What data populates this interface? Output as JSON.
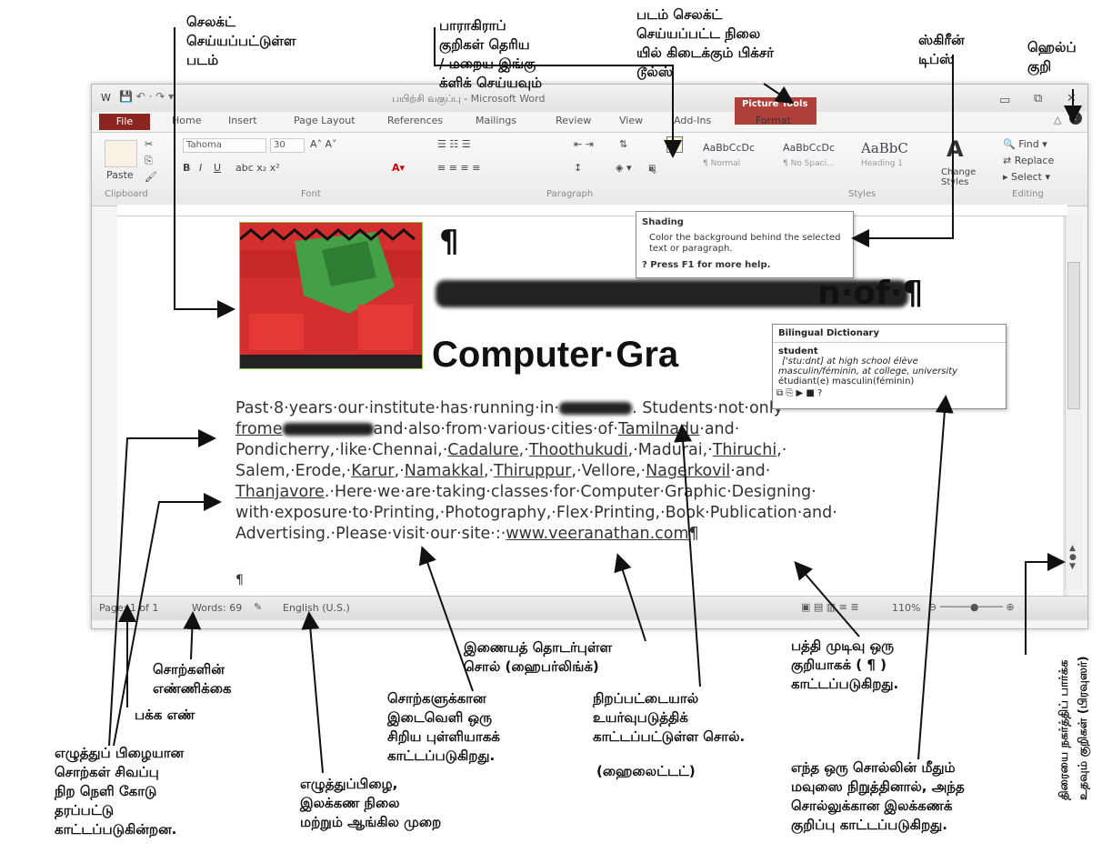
{
  "word": {
    "title": "பயிற்சி வகுப்பு - Microsoft Word",
    "file_tab": "File",
    "tabs": [
      "Home",
      "Insert",
      "Page Layout",
      "References",
      "Mailings",
      "Review",
      "View",
      "Add-Ins",
      "Format"
    ],
    "picture_tools": "Picture Tools",
    "font_name": "Tahoma",
    "font_size": "30",
    "groups": {
      "clipboard": "Clipboard",
      "font": "Font",
      "paragraph": "Paragraph",
      "styles": "Styles",
      "editing": "Editing"
    },
    "paste_label": "Paste",
    "styles": [
      "AaBbCcDc",
      "AaBbCcDc",
      "AaBbC"
    ],
    "style_names": [
      "¶ Normal",
      "¶ No Spaci...",
      "Heading 1"
    ],
    "change_styles": "Change Styles",
    "editing": {
      "find": "Find",
      "replace": "Replace",
      "select": "Select"
    },
    "tooltip": {
      "title": "Shading",
      "body": "Color the background behind the selected text or paragraph.",
      "help": "Press F1 for more help."
    },
    "dictionary": {
      "title": "Bilingual Dictionary",
      "word": "student",
      "line1": "['stu:dnt] at high school élève",
      "line2": "masculin/féminin, at college, university",
      "line3": "étudiant(e) masculin(féminin)"
    },
    "document": {
      "pilcrow_top": "¶",
      "heading1_tail": "n·of·¶",
      "heading2": "Computer·Gra",
      "para_line1_a": "Past·8·years·our·institute·has·running·in·",
      "para_line1_b": ". Students·not·only·",
      "para_line2_a": "frome",
      "para_line2_b": "and·also·from·various·cities·of·",
      "para_line2_link": "Tamilnadu",
      "para_line2_c": "·and·",
      "para_line3": [
        [
          "Pondicherry,·like·Chennai,·",
          false
        ],
        [
          "Cadalure",
          true
        ],
        [
          ",·",
          false
        ],
        [
          "Thoothukudi",
          true
        ],
        [
          ",·Madurai,·",
          false
        ],
        [
          "Thiruchi",
          true
        ],
        [
          ",·",
          false
        ]
      ],
      "para_line4": [
        [
          "Salem,·Erode,·",
          false
        ],
        [
          "Karur",
          true
        ],
        [
          ",·",
          false
        ],
        [
          "Namakkal",
          true
        ],
        [
          ",·",
          false
        ],
        [
          "Thiruppur",
          true
        ],
        [
          ",·Vellore,·",
          false
        ],
        [
          "Nagerkovil",
          true
        ],
        [
          "·and·",
          false
        ]
      ],
      "para_line5_link": "Thanjavore",
      "para_line5_b": ".·Here·we·are·taking·classes·for·Computer·Graphic·Designing·",
      "para_line6": "with·exposure·to·Printing,·Photography,·Flex·Printing,·Book·Publication·and·",
      "para_line7_a": "Advertising.·Please·visit·our·site·:·",
      "para_line7_link": "www.veeranathan.com",
      "para_line7_end": "¶",
      "pilcrow_bottom": "¶"
    },
    "status": {
      "page": "Page: 1 of 1",
      "words": "Words: 69",
      "language": "English (U.S.)",
      "zoom": "110%"
    }
  },
  "annotations": {
    "selected_picture": "செலக்ட்\nசெய்யப்பட்டுள்ள\nபடம்",
    "paragraph_marks": "பாராகிராப்\nகுறிகள் தெரிய\n/ மறைய இங்கு\nக்ளிக் செய்யவும்",
    "picture_tools": "படம் செலக்ட்\nசெய்யப்பட்ட நிலை\nயில் கிடைக்கும் பிக்சர்\nடூல்ஸ்",
    "screen_tips": "ஸ்கிரீன்\nடிப்ஸ்",
    "help": "ஹெல்ப்\nகுறி",
    "hyperlink": "இணையத் தொடர்புள்ள\nசொல் (ஹைபர்லிங்க்)",
    "paragraph_end": "பத்தி முடிவு ஒரு\nகுறியாகக் ( ¶ )\nகாட்டப்படுகிறது.",
    "word_count": "சொற்களின்\nஎண்ணிக்கை",
    "page_number": "பக்க எண்",
    "spaces": "சொற்களுக்கான\nஇடைவெளி ஒரு\nசிறிய புள்ளியாகக்\nகாட்டப்படுகிறது.",
    "highlight": "நிறப்பட்டையால்\nஉயர்வுபடுத்திக்\nகாட்டப்பட்டுள்ள சொல்.",
    "highlight_en": "(ஹைலைட்டட்)",
    "spelling_error": "எழுத்துப் பிழையான\nசொற்கள் சிவப்பு\nநிற நெளி கோடு\nதரப்பட்டு\nகாட்டப்படுகின்றன.",
    "proofing": "எழுத்துப்பிழை,\nஇலக்கண நிலை\nமற்றும் ஆங்கில முறை",
    "dictionary_hover": "எந்த ஒரு சொல்லின் மீதும்\nமவுஸை நிறுத்தினால், அந்த\nசொல்லுக்கான இலக்கணக்\nகுறிப்பு காட்டப்படுகிறது.",
    "browse_object": "திரையை நகர்த்திப் பார்க்க\nஉதவும் குறிகள் (பிரவுஸர்)"
  },
  "colors": {
    "file_tab": "#8a2520",
    "picture_tools": "#b0403a",
    "highlight": "#222222",
    "link_underline": "#333333"
  }
}
